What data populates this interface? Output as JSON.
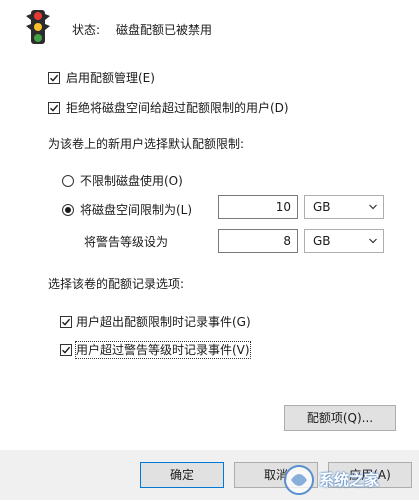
{
  "status": {
    "label": "状态:",
    "value": "磁盘配额已被禁用"
  },
  "options": {
    "enable_quota": {
      "label": "启用配额管理(E)",
      "checked": true
    },
    "deny_space": {
      "label": "拒绝将磁盘空间给超过配额限制的用户(D)",
      "checked": true
    }
  },
  "default_limit": {
    "heading": "为该卷上的新用户选择默认配额限制:",
    "no_limit": {
      "label": "不限制磁盘使用(O)",
      "selected": false
    },
    "limit": {
      "label": "将磁盘空间限制为(L)",
      "selected": true,
      "value": "10",
      "unit": "GB"
    },
    "warning": {
      "label": "将警告等级设为",
      "value": "8",
      "unit": "GB"
    }
  },
  "logging": {
    "heading": "选择该卷的配额记录选项:",
    "log_limit": {
      "label": "用户超出配额限制时记录事件(G)",
      "checked": true
    },
    "log_warning": {
      "label": "用户超过警告等级时记录事件(V)",
      "checked": true
    }
  },
  "buttons": {
    "quota_entries": "配额项(Q)...",
    "ok": "确定",
    "cancel": "取消",
    "apply": "应用(A)"
  },
  "watermark": {
    "text": "系统之家"
  }
}
